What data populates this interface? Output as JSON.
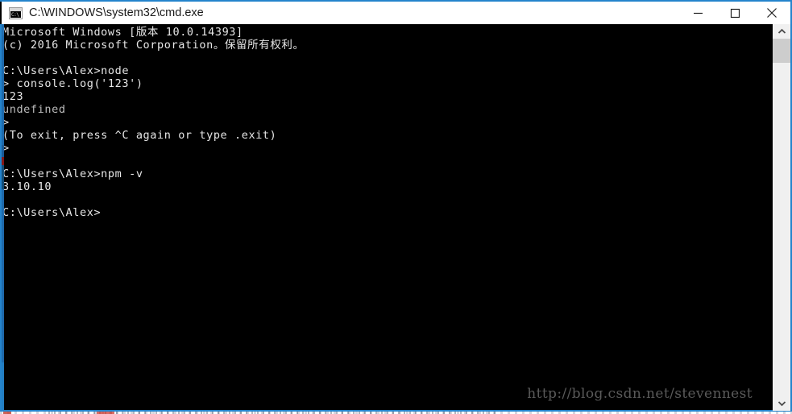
{
  "window": {
    "title": "C:\\WINDOWS\\system32\\cmd.exe",
    "icon_name": "cmd-exe-icon",
    "icon_text": "C:\\",
    "accent_color": "#2484cc",
    "titlebar_bg": "#ffffff",
    "console_bg": "#000000",
    "console_fg": "#d0d0d0",
    "controls": {
      "minimize_label": "Minimize",
      "maximize_label": "Maximize",
      "close_label": "Close"
    }
  },
  "console": {
    "lines": [
      "Microsoft Windows [版本 10.0.14393]",
      "(c) 2016 Microsoft Corporation。保留所有权利。",
      "",
      "C:\\Users\\Alex>node",
      "> console.log('123')",
      "123",
      "undefined",
      ">",
      "(To exit, press ^C again or type .exit)",
      ">",
      "",
      "C:\\Users\\Alex>npm -v",
      "3.10.10",
      "",
      "C:\\Users\\Alex>"
    ]
  },
  "watermark": {
    "text": "http://blog.csdn.net/stevennest"
  },
  "scrollbar": {
    "up_arrow_name": "scroll-up-arrow",
    "down_arrow_name": "scroll-down-arrow",
    "thumb_name": "scroll-thumb"
  }
}
